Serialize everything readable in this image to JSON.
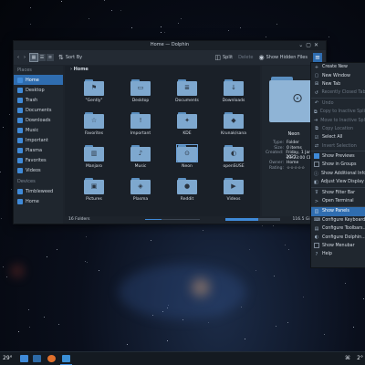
{
  "window": {
    "title": "Home — Dolphin",
    "controls": [
      "⌄",
      "▢",
      "✕"
    ]
  },
  "toolbar": {
    "sort_label": "Sort By",
    "split_label": "Split",
    "delete_label": "Delete",
    "hidden_files_label": "Show Hidden Files"
  },
  "sidebar": {
    "places_label": "Places",
    "devices_label": "Devices",
    "places": [
      "Home",
      "Desktop",
      "Trash",
      "Documents",
      "Downloads",
      "Music",
      "Important",
      "Plasma",
      "Favorites",
      "Videos"
    ],
    "devices": [
      "Timbleweed",
      "Home"
    ]
  },
  "breadcrumb": {
    "path": "Home"
  },
  "files": [
    {
      "name": "\"Gently\"",
      "icon": "kde-logo-icon"
    },
    {
      "name": "Desktop",
      "icon": "desktop-folder-icon"
    },
    {
      "name": "Documents",
      "icon": "documents-folder-icon"
    },
    {
      "name": "Downloads",
      "icon": "downloads-folder-icon"
    },
    {
      "name": "Favorites",
      "icon": "star-folder-icon"
    },
    {
      "name": "Important",
      "icon": "important-folder-icon"
    },
    {
      "name": "KDE",
      "icon": "kde-folder-icon"
    },
    {
      "name": "Krunak/sana",
      "icon": "android-folder-icon"
    },
    {
      "name": "Manjaro",
      "icon": "manjaro-folder-icon"
    },
    {
      "name": "Music",
      "icon": "music-folder-icon"
    },
    {
      "name": "Neon",
      "icon": "neon-folder-icon"
    },
    {
      "name": "openSUSE",
      "icon": "opensuse-folder-icon"
    },
    {
      "name": "Pictures",
      "icon": "pictures-folder-icon"
    },
    {
      "name": "Plasma",
      "icon": "plasma-folder-icon"
    },
    {
      "name": "Reddit",
      "icon": "reddit-folder-icon"
    },
    {
      "name": "Videos",
      "icon": "videos-folder-icon"
    }
  ],
  "status": {
    "folder_count": "16 Folders",
    "free_space": "116.5 GiB free",
    "zoom_fraction": 0.3,
    "used_fraction": 0.6
  },
  "info_panel": {
    "name": "Neon",
    "rows": [
      {
        "k": "Type:",
        "v": "Folder"
      },
      {
        "k": "Size:",
        "v": "0 items"
      },
      {
        "k": "Created:",
        "v": "Friday, 1 January 2021"
      },
      {
        "k": "",
        "v": "23:23:00 CET"
      },
      {
        "k": "Owner:",
        "v": "Home"
      },
      {
        "k": "Rating:",
        "v": "☆☆☆☆☆"
      }
    ]
  },
  "menu": {
    "items": [
      {
        "label": "Create New",
        "icon": "plus-icon",
        "state": "normal"
      },
      {
        "label": "New Window",
        "icon": "window-icon",
        "state": "normal"
      },
      {
        "label": "New Tab",
        "icon": "tab-icon",
        "state": "normal"
      },
      {
        "label": "Recently Closed Tabs",
        "icon": "history-icon",
        "state": "disabled"
      },
      {
        "sep": true
      },
      {
        "label": "Undo",
        "icon": "undo-icon",
        "state": "disabled"
      },
      {
        "label": "Copy to Inactive Split View",
        "icon": "copy-icon",
        "state": "disabled"
      },
      {
        "label": "Move to Inactive Split View",
        "icon": "move-icon",
        "state": "disabled"
      },
      {
        "label": "Copy Location",
        "icon": "copy-location-icon",
        "state": "disabled"
      },
      {
        "label": "Select All",
        "icon": "select-all-icon",
        "state": "normal"
      },
      {
        "label": "Invert Selection",
        "icon": "invert-icon",
        "state": "disabled"
      },
      {
        "sep": true
      },
      {
        "label": "Show Previews",
        "icon": "checkbox",
        "state": "checked"
      },
      {
        "label": "Show in Groups",
        "icon": "checkbox",
        "state": "unchecked"
      },
      {
        "label": "Show Additional Information",
        "icon": "info-icon",
        "state": "normal"
      },
      {
        "label": "Adjust View Display Style",
        "icon": "adjust-icon",
        "state": "normal"
      },
      {
        "sep": true
      },
      {
        "label": "Show Filter Bar",
        "icon": "filter-icon",
        "state": "normal"
      },
      {
        "label": "Open Terminal",
        "icon": "terminal-icon",
        "state": "normal"
      },
      {
        "sep": true
      },
      {
        "label": "Show Panels",
        "icon": "panels-icon",
        "state": "highlighted"
      },
      {
        "label": "Configure Keyboard Shortcuts",
        "icon": "keyboard-icon",
        "state": "normal"
      },
      {
        "label": "Configure Toolbars...",
        "icon": "toolbar-icon",
        "state": "normal"
      },
      {
        "label": "Configure Dolphin...",
        "icon": "dolphin-icon",
        "state": "normal"
      },
      {
        "label": "Show Menubar",
        "icon": "checkbox",
        "state": "unchecked"
      },
      {
        "label": "Help",
        "icon": "help-icon",
        "state": "normal"
      }
    ]
  },
  "taskbar": {
    "temp_left": "29°",
    "temp_right": "2°"
  },
  "colors": {
    "accent": "#2f6db0",
    "folder": "#7ea8cf"
  }
}
